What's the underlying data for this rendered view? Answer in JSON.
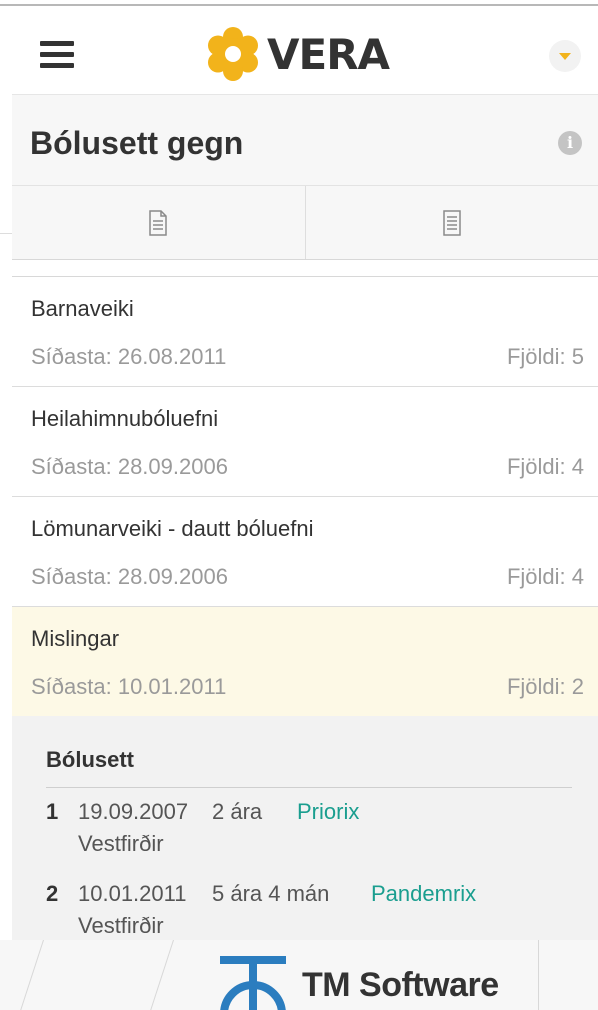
{
  "app": {
    "brand_name": "VERA",
    "brand_color": "#f2b31b",
    "accent_color": "#1a9e8f"
  },
  "header": {
    "menu_icon": "hamburger-icon",
    "dropdown_icon": "caret-down-icon"
  },
  "page": {
    "title": "Bólusett gegn",
    "info_icon": "info-icon"
  },
  "tabs": [
    {
      "icon": "document-icon"
    },
    {
      "icon": "list-document-icon"
    }
  ],
  "vaccines": [
    {
      "name": "Barnaveiki",
      "last": "Síðasta: 26.08.2011",
      "count": "Fjöldi: 5",
      "selected": false
    },
    {
      "name": "Heilahimnubóluefni",
      "last": "Síðasta: 28.09.2006",
      "count": "Fjöldi: 4",
      "selected": false
    },
    {
      "name": "Lömunarveiki - dautt bóluefni",
      "last": "Síðasta: 28.09.2006",
      "count": "Fjöldi: 4",
      "selected": false
    },
    {
      "name": "Mislingar",
      "last": "Síðasta: 10.01.2011",
      "count": "Fjöldi: 2",
      "selected": true
    }
  ],
  "detail": {
    "title": "Bólusett",
    "doses": [
      {
        "num": "1",
        "date": "19.09.2007",
        "age": "2 ára",
        "vaccine": "Priorix",
        "region": "Vestfirðir"
      },
      {
        "num": "2",
        "date": "10.01.2011",
        "age": "5 ára 4 mán",
        "vaccine": "Pandemrix",
        "region": "Vestfirðir"
      }
    ]
  },
  "footer": {
    "company": "TM Software"
  }
}
